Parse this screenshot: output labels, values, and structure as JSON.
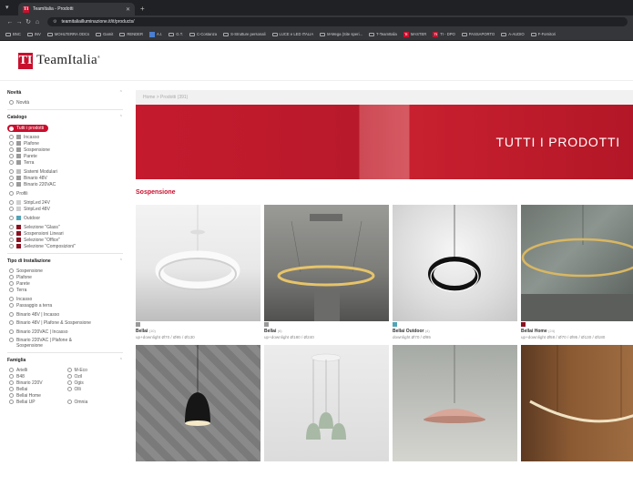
{
  "browser": {
    "tab_title": "TeamItalia - Prodotti",
    "url": "teamitaliailluminazione.it/it/products/",
    "bookmarks": [
      "BNC",
      "INV",
      "MOHLTERRA ODCs",
      "Gamit",
      "RENDER",
      "A.I.",
      "G.T.",
      "C-Costanza",
      "S-Strutture personali",
      "LUCE e LED ITALIA",
      "M-Mega (Site speri...",
      "T-TeamItalia",
      "MASTER",
      "TI - DPO",
      "PASSAPORTO",
      "A-AUDIO",
      "F-Fornitori"
    ]
  },
  "site": {
    "logo_mark": "TI",
    "logo_text": "TeamItalia",
    "logo_reg": "®"
  },
  "breadcrumb": "Home  >  Prodotti (391)",
  "hero_title": "TUTTI I PRODOTTI",
  "category_title": "Sospensione",
  "sidebar": {
    "novita": {
      "title": "Novità",
      "options": [
        "Novità"
      ]
    },
    "catalogo": {
      "title": "Catalogo",
      "selected": "Tutti i prodotti",
      "groups": [
        [
          {
            "label": "Incasso",
            "color": "#9a9a9a"
          },
          {
            "label": "Plafone",
            "color": "#9a9a9a"
          },
          {
            "label": "Sospensione",
            "color": "#9a9a9a"
          },
          {
            "label": "Parete",
            "color": "#9a9a9a"
          },
          {
            "label": "Terra",
            "color": "#9a9a9a"
          }
        ],
        [
          {
            "label": "Sistemi Modulari",
            "color": "#bdbdbd"
          },
          {
            "label": "Binario 48V",
            "color": "#9a9a9a"
          },
          {
            "label": "Binario 220VAC",
            "color": "#9a9a9a"
          }
        ],
        [
          {
            "label": "Profili",
            "color": ""
          }
        ],
        [
          {
            "label": "StripLed 24V",
            "color": "#cfcfcf"
          },
          {
            "label": "StripLed 48V",
            "color": "#cfcfcf"
          }
        ],
        [
          {
            "label": "Outdoor",
            "color": "#4fa5b7"
          }
        ],
        [
          {
            "label": "Selezione \"Glass\"",
            "color": "#8b1020"
          },
          {
            "label": "Sospensioni Lineari",
            "color": "#8b1020"
          },
          {
            "label": "Selezione \"Office\"",
            "color": "#8b1020"
          },
          {
            "label": "Selezione \"Composizioni\"",
            "color": "#8b1020"
          }
        ]
      ]
    },
    "installazione": {
      "title": "Tipo di Installazione",
      "groups": [
        [
          "Sospensione",
          "Plafone",
          "Parete",
          "Terra"
        ],
        [
          "Incasso",
          "Passaggio a terra"
        ],
        [
          "Binario 48V | Incasso"
        ],
        [
          "Binario 48V | Plafone & Sospensione"
        ],
        [
          "Binario 220VAC | Incasso"
        ],
        [
          "Binario 220VAC | Plafone & Sospensione"
        ]
      ]
    },
    "famiglia": {
      "title": "Famiglia",
      "left": [
        "Arielli",
        "B48",
        "Binario 220V",
        "Bellai",
        "Bellai Home",
        "Bellai UP"
      ],
      "right": [
        "M-Eco",
        "Ozil",
        "Ogis",
        "Olli",
        "",
        "Omnia"
      ]
    }
  },
  "products": [
    {
      "name": "Bellai",
      "count": "(10)",
      "desc": "up+downlight Ø70 / Ø95 / Ø130",
      "swatch": "#9a9a9a"
    },
    {
      "name": "Bellai",
      "count": "(6)",
      "desc": "up+downlight Ø180 / Ø240",
      "swatch": "#9a9a9a"
    },
    {
      "name": "Bellai Outdoor",
      "count": "(4)",
      "desc": "downlight Ø70 / Ø95",
      "swatch": "#4fa5b7"
    },
    {
      "name": "Bellai Home",
      "count": "(24)",
      "desc": "up+downlight Ø58 / Ø70 / Ø95 / Ø130 / Ø180",
      "swatch": "#8b1020"
    },
    {
      "name": "",
      "count": "",
      "desc": "",
      "swatch": ""
    },
    {
      "name": "",
      "count": "",
      "desc": "",
      "swatch": ""
    },
    {
      "name": "",
      "count": "",
      "desc": "",
      "swatch": ""
    },
    {
      "name": "",
      "count": "",
      "desc": "",
      "swatch": ""
    }
  ],
  "colors": {
    "brand": "#c8102e",
    "outdoor": "#4fa5b7",
    "selection": "#8b1020"
  },
  "icons": [
    "menu-icon",
    "back-icon",
    "forward-icon",
    "reload-icon",
    "home-icon",
    "site-info-icon",
    "folder-icon",
    "chevron-up-icon",
    "tab-close-icon",
    "new-tab-icon"
  ]
}
